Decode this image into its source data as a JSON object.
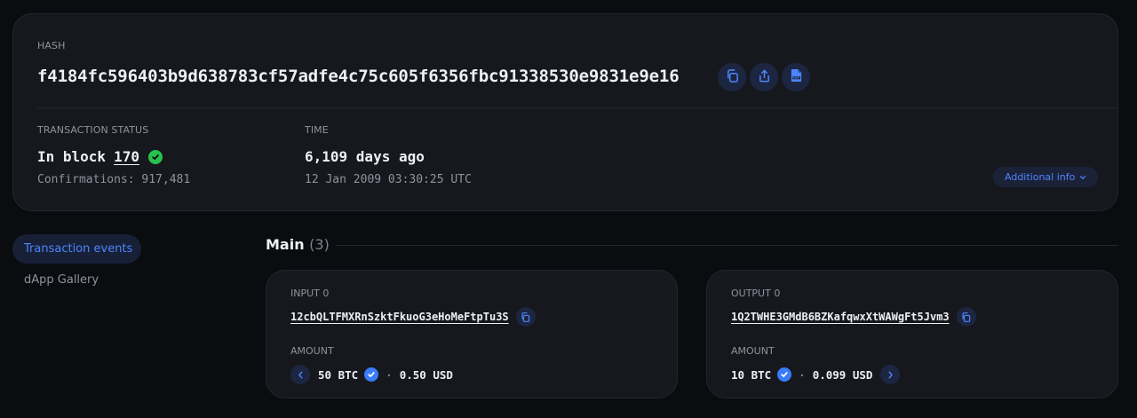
{
  "transaction": {
    "hash_label": "HASH",
    "hash": "f4184fc596403b9d638783cf57adfe4c75c605f6356fbc91338530e9831e9e16",
    "status_label": "TRANSACTION STATUS",
    "status_prefix": "In block",
    "block_number": "170",
    "confirmations": "Confirmations: 917,481",
    "time_label": "TIME",
    "time_ago": "6,109 days ago",
    "time_date": "12 Jan 2009 03:30:25 UTC",
    "additional_info": "Additional info"
  },
  "icons": {
    "copy": "copy-icon",
    "share": "share-icon",
    "pdf": "pdf-icon",
    "check": "check-circle-icon",
    "chevron_down": "chevron-down-icon",
    "chevron_left": "chevron-left-icon",
    "chevron_right": "chevron-right-icon"
  },
  "nav": {
    "items": [
      {
        "label": "Transaction events",
        "active": true
      },
      {
        "label": "dApp Gallery",
        "active": false
      }
    ]
  },
  "main": {
    "title": "Main",
    "count": "(3)",
    "input": {
      "label": "INPUT 0",
      "address": "12cbQLTFMXRnSzktFkuoG3eHoMeFtpTu3S",
      "amount_label": "AMOUNT",
      "amount": "50 BTC",
      "usd": "0.50 USD"
    },
    "output": {
      "label": "OUTPUT 0",
      "address": "1Q2TWHE3GMdB6BZKafqwxXtWAWgFt5Jvm3",
      "amount_label": "AMOUNT",
      "amount": "10 BTC",
      "usd": "0.099 USD"
    }
  },
  "colors": {
    "background": "#0b0c10",
    "card": "#16181e",
    "accent": "#4d85ff",
    "success": "#27c24c"
  }
}
